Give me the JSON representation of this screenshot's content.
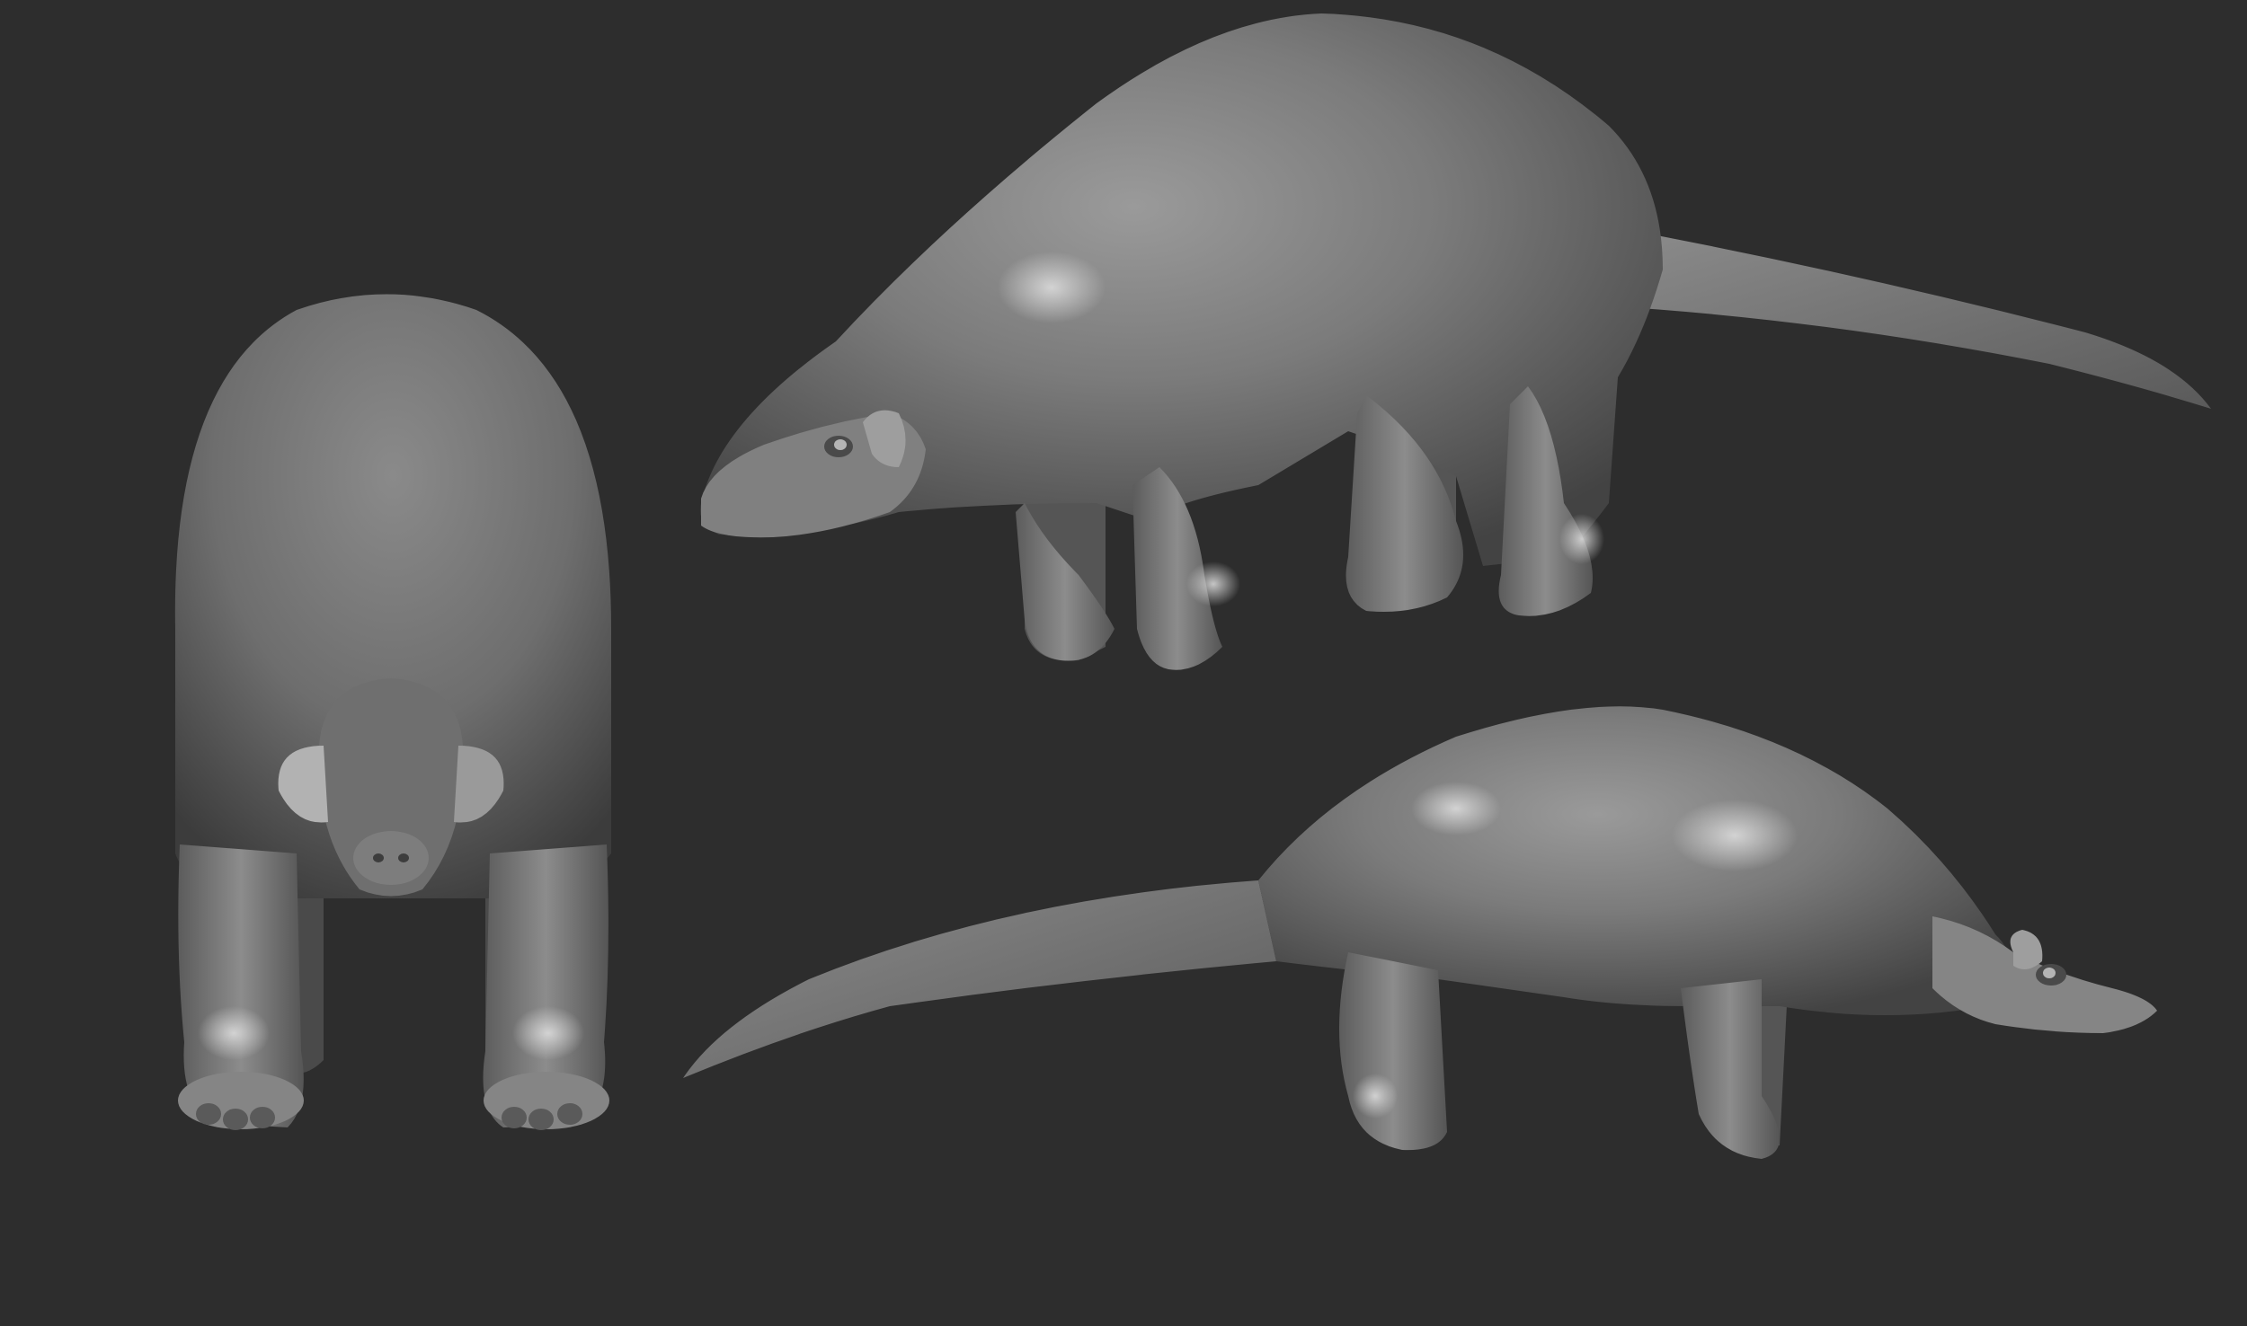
{
  "scene": {
    "background_color": "#2d2d2d",
    "clay_color": "#7a7a7a",
    "clay_highlight": "#bdbdbd",
    "clay_shadow": "#3e3e3e",
    "models": [
      {
        "view": "front",
        "subject": "quadruped-creature-sculpt-front"
      },
      {
        "view": "side-left",
        "subject": "quadruped-creature-sculpt-left-profile"
      },
      {
        "view": "side-right",
        "subject": "quadruped-creature-sculpt-right-profile"
      }
    ]
  }
}
